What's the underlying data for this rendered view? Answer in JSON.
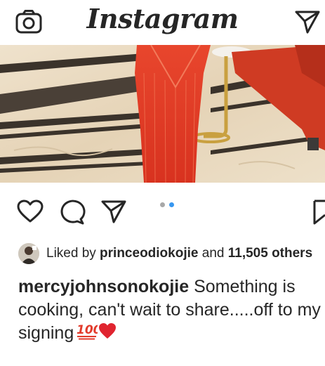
{
  "header": {
    "logo_text": "Instagram"
  },
  "icons": {
    "camera": "camera-icon",
    "direct": "paper-plane-icon",
    "like": "heart-outline-icon",
    "comment": "comment-bubble-icon",
    "share": "paper-plane-icon",
    "save": "bookmark-icon"
  },
  "carousel": {
    "total": 2,
    "active_index": 1,
    "active_color": "#3897f0",
    "inactive_color": "#a8a8a8"
  },
  "post": {
    "liked_by_prefix": "Liked by ",
    "liked_by_user": "princeodiokojie",
    "liked_by_and": " and ",
    "liked_by_count": "11,505 others",
    "caption_user": "mercyjohnsonokojie",
    "caption_text": " Something is cooking, can't wait to share.....off to my signing",
    "caption_emojis": [
      "hundred-points-emoji",
      "red-heart-emoji"
    ]
  },
  "colors": {
    "text": "#262626",
    "heart_red": "#e0242f",
    "emoji_red": "#e23b2b"
  }
}
